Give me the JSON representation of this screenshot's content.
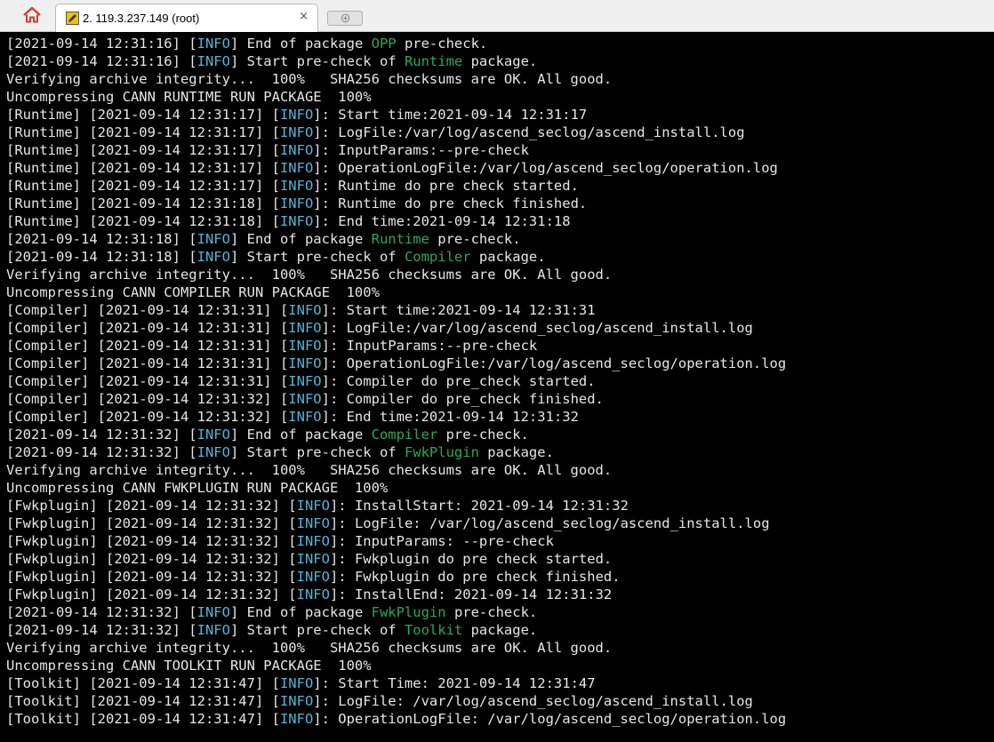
{
  "tabbar": {
    "tab_title": "2. 119.3.237.149 (root)",
    "close_label": "×",
    "home_icon": "home-icon",
    "session_icon": "pencil-terminal-icon",
    "new_tab_icon": "add-tab-icon"
  },
  "colors": {
    "background": "#000000",
    "text": "#e6e6e6",
    "info": "#4fb6d6",
    "package": "#27a95a"
  },
  "terminal": {
    "lines": [
      [
        {
          "t": "[2021-09-14 12:31:16] ["
        },
        {
          "t": "INFO",
          "c": "cyan"
        },
        {
          "t": "] End of package "
        },
        {
          "t": "OPP",
          "c": "green"
        },
        {
          "t": " pre-check."
        }
      ],
      [
        {
          "t": "[2021-09-14 12:31:16] ["
        },
        {
          "t": "INFO",
          "c": "cyan"
        },
        {
          "t": "] Start pre-check of "
        },
        {
          "t": "Runtime",
          "c": "green"
        },
        {
          "t": " package."
        }
      ],
      [
        {
          "t": "Verifying archive integrity...  100%   SHA256 checksums are OK. All good."
        }
      ],
      [
        {
          "t": "Uncompressing CANN RUNTIME RUN PACKAGE  100%"
        }
      ],
      [
        {
          "t": "[Runtime] [2021-09-14 12:31:17] ["
        },
        {
          "t": "INFO",
          "c": "cyan"
        },
        {
          "t": "]: Start time:2021-09-14 12:31:17"
        }
      ],
      [
        {
          "t": "[Runtime] [2021-09-14 12:31:17] ["
        },
        {
          "t": "INFO",
          "c": "cyan"
        },
        {
          "t": "]: LogFile:/var/log/ascend_seclog/ascend_install.log"
        }
      ],
      [
        {
          "t": "[Runtime] [2021-09-14 12:31:17] ["
        },
        {
          "t": "INFO",
          "c": "cyan"
        },
        {
          "t": "]: InputParams:--pre-check"
        }
      ],
      [
        {
          "t": "[Runtime] [2021-09-14 12:31:17] ["
        },
        {
          "t": "INFO",
          "c": "cyan"
        },
        {
          "t": "]: OperationLogFile:/var/log/ascend_seclog/operation.log"
        }
      ],
      [
        {
          "t": "[Runtime] [2021-09-14 12:31:17] ["
        },
        {
          "t": "INFO",
          "c": "cyan"
        },
        {
          "t": "]: Runtime do pre check started."
        }
      ],
      [
        {
          "t": "[Runtime] [2021-09-14 12:31:18] ["
        },
        {
          "t": "INFO",
          "c": "cyan"
        },
        {
          "t": "]: Runtime do pre check finished."
        }
      ],
      [
        {
          "t": "[Runtime] [2021-09-14 12:31:18] ["
        },
        {
          "t": "INFO",
          "c": "cyan"
        },
        {
          "t": "]: End time:2021-09-14 12:31:18"
        }
      ],
      [
        {
          "t": "[2021-09-14 12:31:18] ["
        },
        {
          "t": "INFO",
          "c": "cyan"
        },
        {
          "t": "] End of package "
        },
        {
          "t": "Runtime",
          "c": "green"
        },
        {
          "t": " pre-check."
        }
      ],
      [
        {
          "t": "[2021-09-14 12:31:18] ["
        },
        {
          "t": "INFO",
          "c": "cyan"
        },
        {
          "t": "] Start pre-check of "
        },
        {
          "t": "Compiler",
          "c": "green"
        },
        {
          "t": " package."
        }
      ],
      [
        {
          "t": "Verifying archive integrity...  100%   SHA256 checksums are OK. All good."
        }
      ],
      [
        {
          "t": "Uncompressing CANN COMPILER RUN PACKAGE  100%"
        }
      ],
      [
        {
          "t": "[Compiler] [2021-09-14 12:31:31] ["
        },
        {
          "t": "INFO",
          "c": "cyan"
        },
        {
          "t": "]: Start time:2021-09-14 12:31:31"
        }
      ],
      [
        {
          "t": "[Compiler] [2021-09-14 12:31:31] ["
        },
        {
          "t": "INFO",
          "c": "cyan"
        },
        {
          "t": "]: LogFile:/var/log/ascend_seclog/ascend_install.log"
        }
      ],
      [
        {
          "t": "[Compiler] [2021-09-14 12:31:31] ["
        },
        {
          "t": "INFO",
          "c": "cyan"
        },
        {
          "t": "]: InputParams:--pre-check"
        }
      ],
      [
        {
          "t": "[Compiler] [2021-09-14 12:31:31] ["
        },
        {
          "t": "INFO",
          "c": "cyan"
        },
        {
          "t": "]: OperationLogFile:/var/log/ascend_seclog/operation.log"
        }
      ],
      [
        {
          "t": "[Compiler] [2021-09-14 12:31:31] ["
        },
        {
          "t": "INFO",
          "c": "cyan"
        },
        {
          "t": "]: Compiler do pre_check started."
        }
      ],
      [
        {
          "t": "[Compiler] [2021-09-14 12:31:32] ["
        },
        {
          "t": "INFO",
          "c": "cyan"
        },
        {
          "t": "]: Compiler do pre_check finished."
        }
      ],
      [
        {
          "t": "[Compiler] [2021-09-14 12:31:32] ["
        },
        {
          "t": "INFO",
          "c": "cyan"
        },
        {
          "t": "]: End time:2021-09-14 12:31:32"
        }
      ],
      [
        {
          "t": "[2021-09-14 12:31:32] ["
        },
        {
          "t": "INFO",
          "c": "cyan"
        },
        {
          "t": "] End of package "
        },
        {
          "t": "Compiler",
          "c": "green"
        },
        {
          "t": " pre-check."
        }
      ],
      [
        {
          "t": "[2021-09-14 12:31:32] ["
        },
        {
          "t": "INFO",
          "c": "cyan"
        },
        {
          "t": "] Start pre-check of "
        },
        {
          "t": "FwkPlugin",
          "c": "green"
        },
        {
          "t": " package."
        }
      ],
      [
        {
          "t": "Verifying archive integrity...  100%   SHA256 checksums are OK. All good."
        }
      ],
      [
        {
          "t": "Uncompressing CANN FWKPLUGIN RUN PACKAGE  100%"
        }
      ],
      [
        {
          "t": "[Fwkplugin] [2021-09-14 12:31:32] ["
        },
        {
          "t": "INFO",
          "c": "cyan"
        },
        {
          "t": "]: InstallStart: 2021-09-14 12:31:32"
        }
      ],
      [
        {
          "t": "[Fwkplugin] [2021-09-14 12:31:32] ["
        },
        {
          "t": "INFO",
          "c": "cyan"
        },
        {
          "t": "]: LogFile: /var/log/ascend_seclog/ascend_install.log"
        }
      ],
      [
        {
          "t": "[Fwkplugin] [2021-09-14 12:31:32] ["
        },
        {
          "t": "INFO",
          "c": "cyan"
        },
        {
          "t": "]: InputParams: --pre-check"
        }
      ],
      [
        {
          "t": "[Fwkplugin] [2021-09-14 12:31:32] ["
        },
        {
          "t": "INFO",
          "c": "cyan"
        },
        {
          "t": "]: Fwkplugin do pre check started."
        }
      ],
      [
        {
          "t": "[Fwkplugin] [2021-09-14 12:31:32] ["
        },
        {
          "t": "INFO",
          "c": "cyan"
        },
        {
          "t": "]: Fwkplugin do pre check finished."
        }
      ],
      [
        {
          "t": "[Fwkplugin] [2021-09-14 12:31:32] ["
        },
        {
          "t": "INFO",
          "c": "cyan"
        },
        {
          "t": "]: InstallEnd: 2021-09-14 12:31:32"
        }
      ],
      [
        {
          "t": "[2021-09-14 12:31:32] ["
        },
        {
          "t": "INFO",
          "c": "cyan"
        },
        {
          "t": "] End of package "
        },
        {
          "t": "FwkPlugin",
          "c": "green"
        },
        {
          "t": " pre-check."
        }
      ],
      [
        {
          "t": "[2021-09-14 12:31:32] ["
        },
        {
          "t": "INFO",
          "c": "cyan"
        },
        {
          "t": "] Start pre-check of "
        },
        {
          "t": "Toolkit",
          "c": "green"
        },
        {
          "t": " package."
        }
      ],
      [
        {
          "t": "Verifying archive integrity...  100%   SHA256 checksums are OK. All good."
        }
      ],
      [
        {
          "t": "Uncompressing CANN TOOLKIT RUN PACKAGE  100%"
        }
      ],
      [
        {
          "t": "[Toolkit] [2021-09-14 12:31:47] ["
        },
        {
          "t": "INFO",
          "c": "cyan"
        },
        {
          "t": "]: Start Time: 2021-09-14 12:31:47"
        }
      ],
      [
        {
          "t": "[Toolkit] [2021-09-14 12:31:47] ["
        },
        {
          "t": "INFO",
          "c": "cyan"
        },
        {
          "t": "]: LogFile: /var/log/ascend_seclog/ascend_install.log"
        }
      ],
      [
        {
          "t": "[Toolkit] [2021-09-14 12:31:47] ["
        },
        {
          "t": "INFO",
          "c": "cyan"
        },
        {
          "t": "]: OperationLogFile: /var/log/ascend_seclog/operation.log"
        }
      ]
    ]
  }
}
